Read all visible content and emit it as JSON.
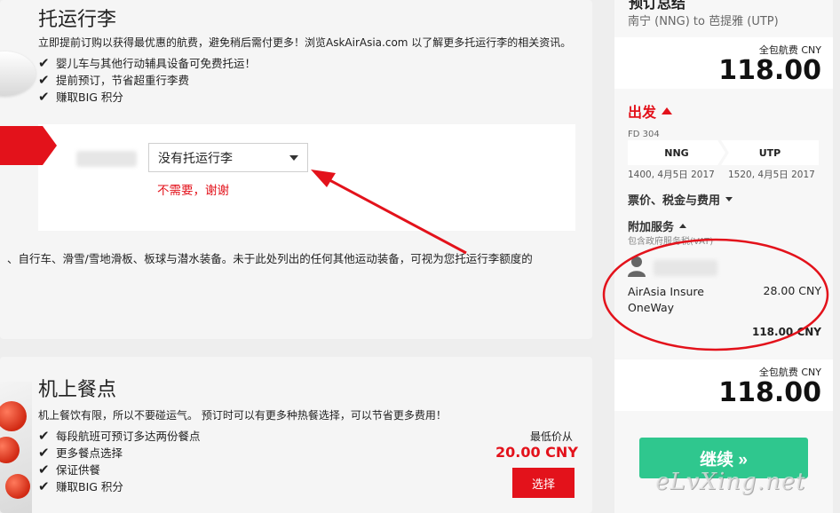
{
  "baggage": {
    "title": "托运行李",
    "description": "立即提前订购以获得最优惠的航费，避免稍后需付更多！浏览AskAirAsia.com 以了解更多托运行李的相关资讯。",
    "benefits": [
      "婴儿车与其他行动辅具设备可免费托运！",
      "提前预订，节省超重行李费",
      "赚取BIG 积分"
    ],
    "select_value": "没有托运行李",
    "hint": "不需要，谢谢",
    "sports_note": "、自行车、滑雪/雪地滑板、板球与潜水装备。未于此处列出的任何其他运动装备，可视为您托运行李额度的"
  },
  "meal": {
    "title": "机上餐点",
    "description": "机上餐饮有限，所以不要碰运气。 预订时可以有更多种热餐选择，可以节省更多费用！",
    "benefits": [
      "每段航班可预订多达两份餐点",
      "更多餐点选择",
      "保证供餐",
      "赚取BIG 积分"
    ],
    "min_price_label": "最低价从",
    "min_price": "20.00 CNY",
    "select_label": "选择"
  },
  "summary": {
    "title": "预订总结",
    "route": "南宁 (NNG) to 芭提雅 (UTP)",
    "total_label": "全包航费 CNY",
    "total_amount": "118.00",
    "depart_label": "出发",
    "flight_no": "FD 304",
    "from_code": "NNG",
    "to_code": "UTP",
    "from_time": "1400, 4月5日 2017",
    "to_time": "1520, 4月5日 2017",
    "fare_toggle": "票价、税金与费用",
    "addon_toggle": "附加服务",
    "vat_note": "包含政府服务税(VAT)",
    "insure_name_1": "AirAsia Insure",
    "insure_name_2": "OneWay",
    "insure_price": "28.00 CNY",
    "insure_subtotal": "118.00 CNY",
    "total_label_2": "全包航费 CNY",
    "total_amount_2": "118.00",
    "continue_label": "继续 »"
  },
  "watermark": "eLvXing.net",
  "colors": {
    "accent_red": "#e3121b",
    "continue_green": "#2fc78e"
  }
}
